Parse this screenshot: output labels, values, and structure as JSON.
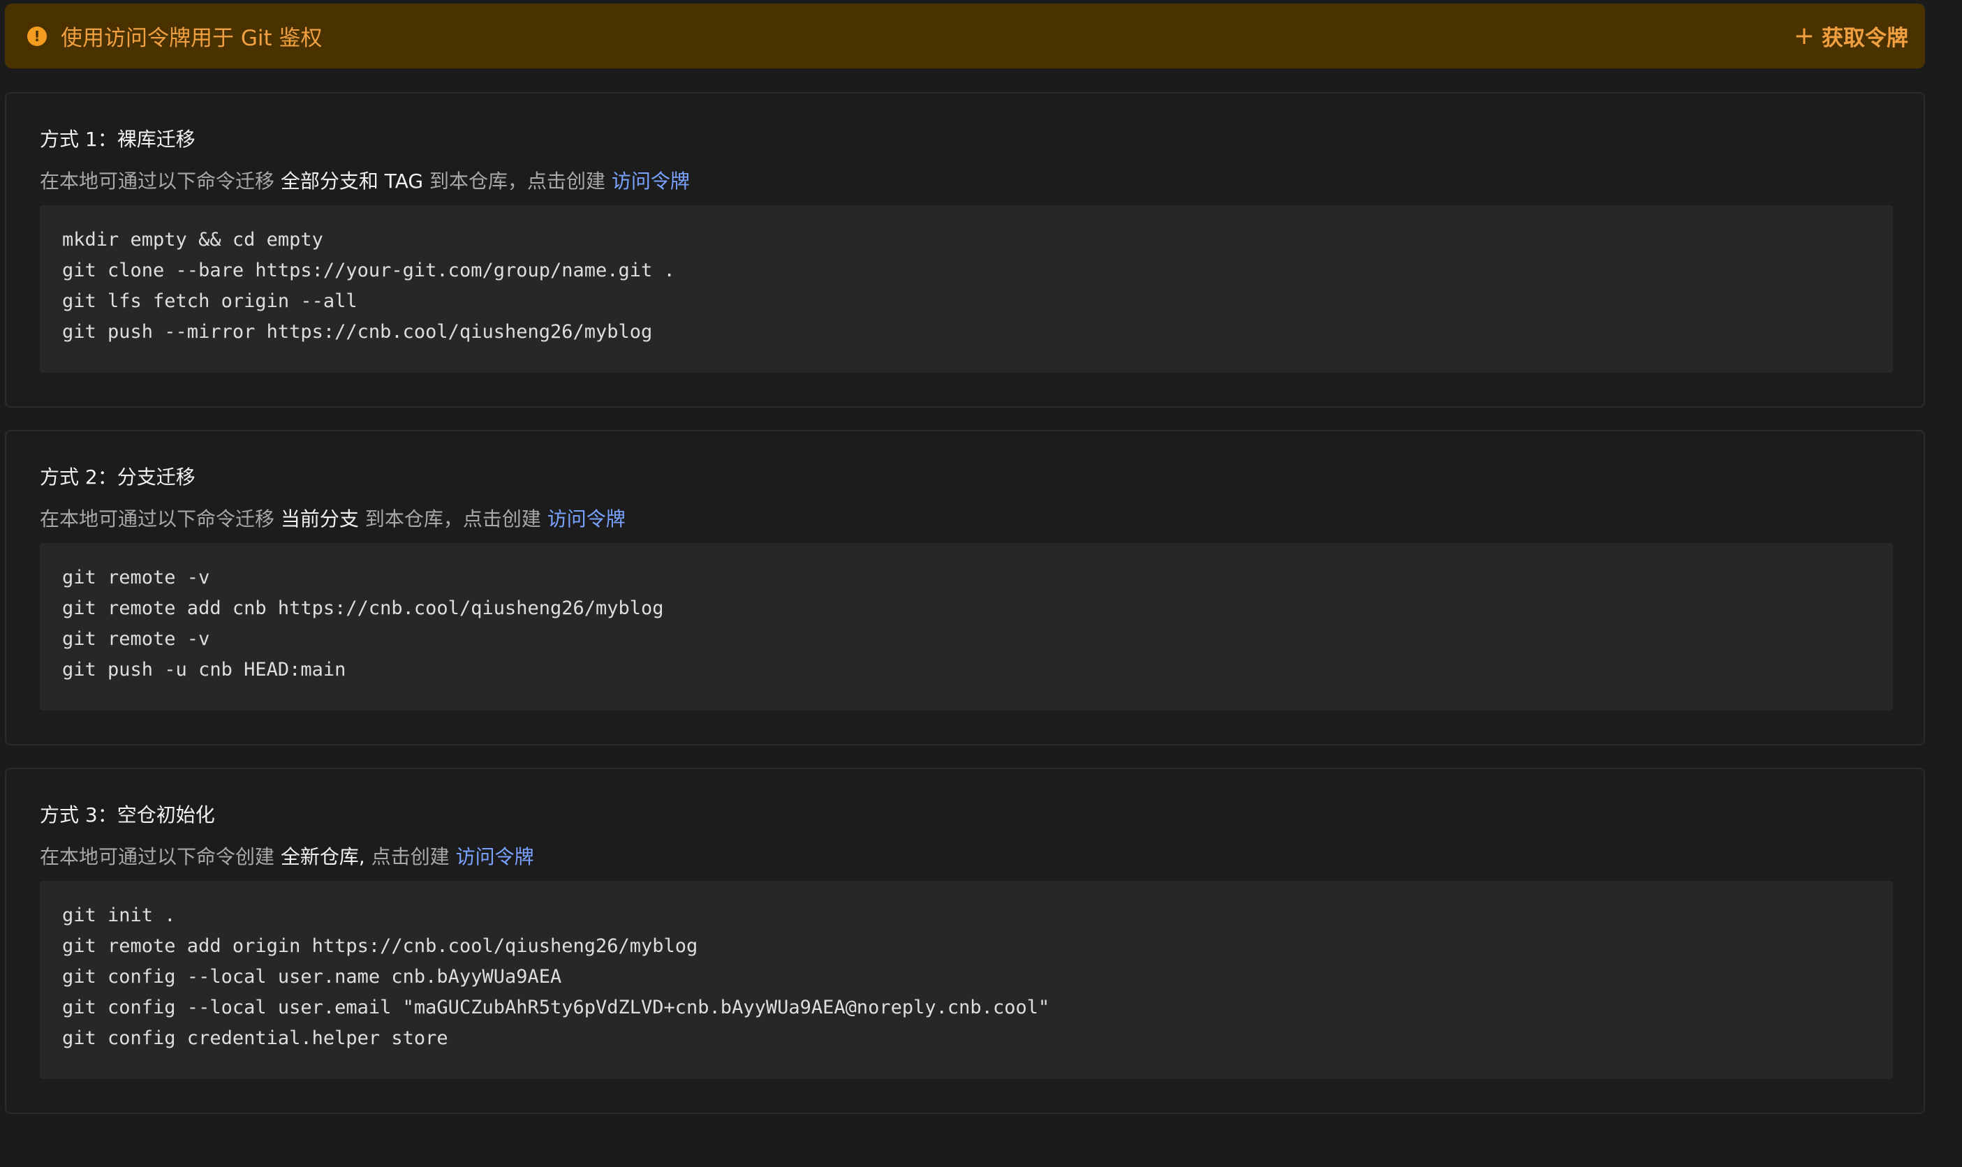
{
  "banner": {
    "icon": "warning-circle-icon",
    "text": "使用访问令牌用于 Git 鉴权",
    "action_icon": "plus-icon",
    "action_label": "获取令牌",
    "colors": {
      "background": "#4a3100",
      "text": "#f0a040",
      "icon": "#f39c1f"
    }
  },
  "methods": [
    {
      "title": "方式 1：裸库迁移",
      "desc_prefix": "在本地可通过以下命令迁移 ",
      "desc_strong": "全部分支和 TAG",
      "desc_middle": " 到本仓库，点击创建 ",
      "desc_link": "访问令牌",
      "code": [
        "mkdir empty && cd empty",
        "git clone --bare https://your-git.com/group/name.git .",
        "git lfs fetch origin --all",
        "git push --mirror https://cnb.cool/qiusheng26/myblog"
      ]
    },
    {
      "title": "方式 2：分支迁移",
      "desc_prefix": "在本地可通过以下命令迁移 ",
      "desc_strong": "当前分支",
      "desc_middle": " 到本仓库，点击创建 ",
      "desc_link": "访问令牌",
      "code": [
        "git remote -v",
        "git remote add cnb https://cnb.cool/qiusheng26/myblog",
        "git remote -v",
        "git push -u cnb HEAD:main"
      ]
    },
    {
      "title": "方式 3：空仓初始化",
      "desc_prefix": "在本地可通过以下命令创建 ",
      "desc_strong": "全新仓库,",
      "desc_middle": " 点击创建 ",
      "desc_link": "访问令牌",
      "code": [
        "git init .",
        "git remote add origin https://cnb.cool/qiusheng26/myblog",
        "git config --local user.name cnb.bAyyWUa9AEA",
        "git config --local user.email \"maGUCZubAhR5ty6pVdZLVD+cnb.bAyyWUa9AEA@noreply.cnb.cool\"",
        "git config credential.helper store"
      ]
    }
  ],
  "colors": {
    "link": "#7aa2ff",
    "page_background": "#1b1b1c",
    "code_background": "#272728"
  }
}
